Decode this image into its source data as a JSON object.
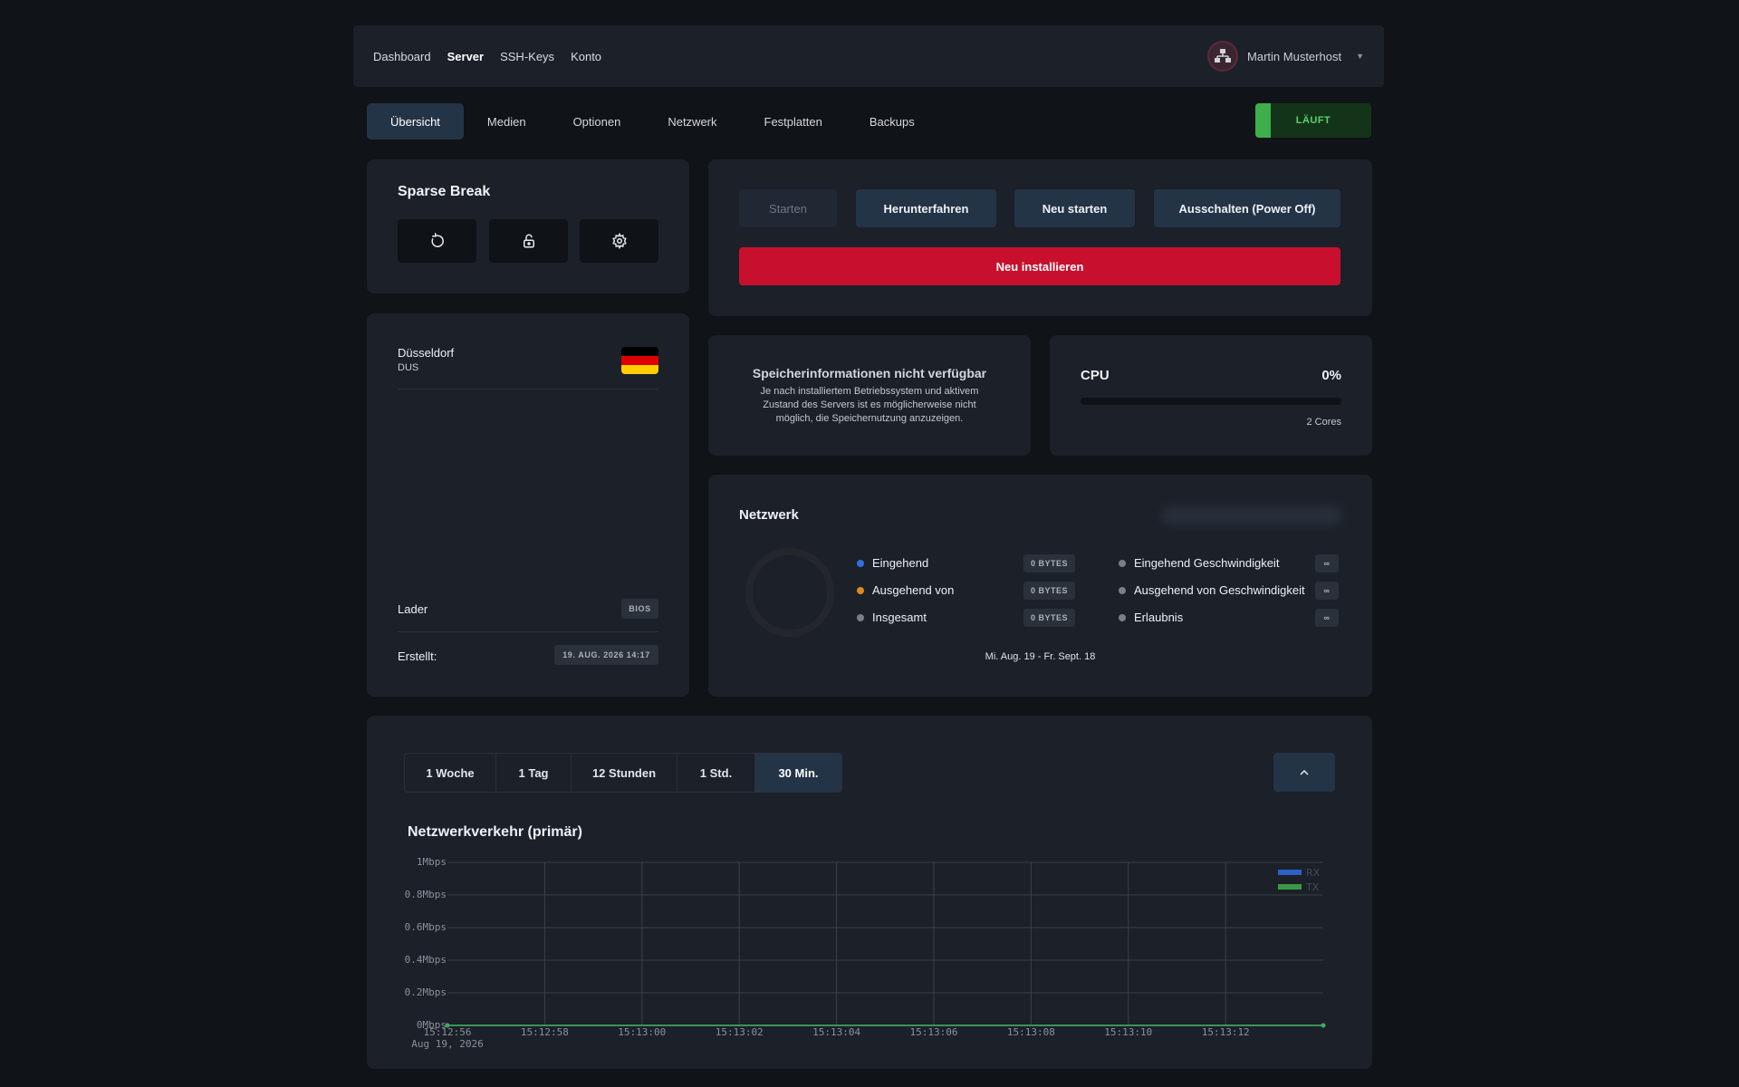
{
  "nav": {
    "links": [
      "Dashboard",
      "Server",
      "SSH-Keys",
      "Konto"
    ],
    "active": "Server",
    "user_name": "Martin Musterhost"
  },
  "tabs": [
    "Übersicht",
    "Medien",
    "Optionen",
    "Netzwerk",
    "Festplatten",
    "Backups"
  ],
  "active_tab": "Übersicht",
  "status": {
    "label": "LÄUFT",
    "color": "#3fae4c"
  },
  "server": {
    "name": "Sparse Break",
    "actions": [
      "reset-icon",
      "lock-icon",
      "gear-icon"
    ]
  },
  "power": {
    "start": "Starten",
    "shutdown": "Herunterfahren",
    "restart": "Neu starten",
    "poweroff": "Ausschalten (Power Off)",
    "reinstall": "Neu installieren"
  },
  "location": {
    "city": "Düsseldorf",
    "code": "DUS",
    "flag_colors": [
      "#000000",
      "#dd0000",
      "#ffce00"
    ],
    "loader_label": "Lader",
    "loader_value": "BIOS",
    "created_label": "Erstellt:",
    "created_value": "19. AUG. 2026 14:17"
  },
  "storage": {
    "title": "Speicherinformationen nicht verfügbar",
    "text": "Je nach installiertem Betriebssystem und aktivem Zustand des Servers ist es möglicherweise nicht möglich, die Speichernutzung anzuzeigen."
  },
  "cpu": {
    "label": "CPU",
    "value": "0%",
    "fill": 0,
    "cores": "2 Cores"
  },
  "network": {
    "title": "Netzwerk",
    "left": [
      {
        "label": "Eingehend",
        "value": "0 BYTES",
        "color": "#2f6fe4"
      },
      {
        "label": "Ausgehend von",
        "value": "0 BYTES",
        "color": "#e08a1e"
      },
      {
        "label": "Insgesamt",
        "value": "0 BYTES",
        "color": "#7a7f87"
      }
    ],
    "right": [
      {
        "label": "Eingehend Geschwindigkeit",
        "value": "∞"
      },
      {
        "label": "Ausgehend von Geschwindigkeit",
        "value": "∞"
      },
      {
        "label": "Erlaubnis",
        "value": "∞"
      }
    ],
    "period": "Mi. Aug. 19 - Fr. Sept. 18"
  },
  "traffic": {
    "ranges": [
      "1 Woche",
      "1 Tag",
      "12 Stunden",
      "1 Std.",
      "30 Min."
    ],
    "active_range": "30 Min.",
    "title": "Netzwerkverkehr (primär)"
  },
  "chart_data": {
    "type": "line",
    "title": "Netzwerkverkehr (primär)",
    "x": [
      "15:12:56",
      "15:12:58",
      "15:13:00",
      "15:13:02",
      "15:13:04",
      "15:13:06",
      "15:13:08",
      "15:13:10",
      "15:13:12"
    ],
    "x_sublabel": "Aug 19, 2026",
    "yticks": [
      "0Mbps",
      "0.2Mbps",
      "0.4Mbps",
      "0.6Mbps",
      "0.8Mbps",
      "1Mbps"
    ],
    "ylim": [
      0,
      1
    ],
    "grid": true,
    "legend_position": "top-right",
    "series": [
      {
        "name": "RX",
        "color": "#2f6fe4",
        "values": [
          0,
          0,
          0,
          0,
          0,
          0,
          0,
          0,
          0,
          0
        ]
      },
      {
        "name": "TX",
        "color": "#3fae4c",
        "values": [
          0,
          0,
          0,
          0,
          0,
          0,
          0,
          0,
          0,
          0
        ]
      }
    ]
  }
}
